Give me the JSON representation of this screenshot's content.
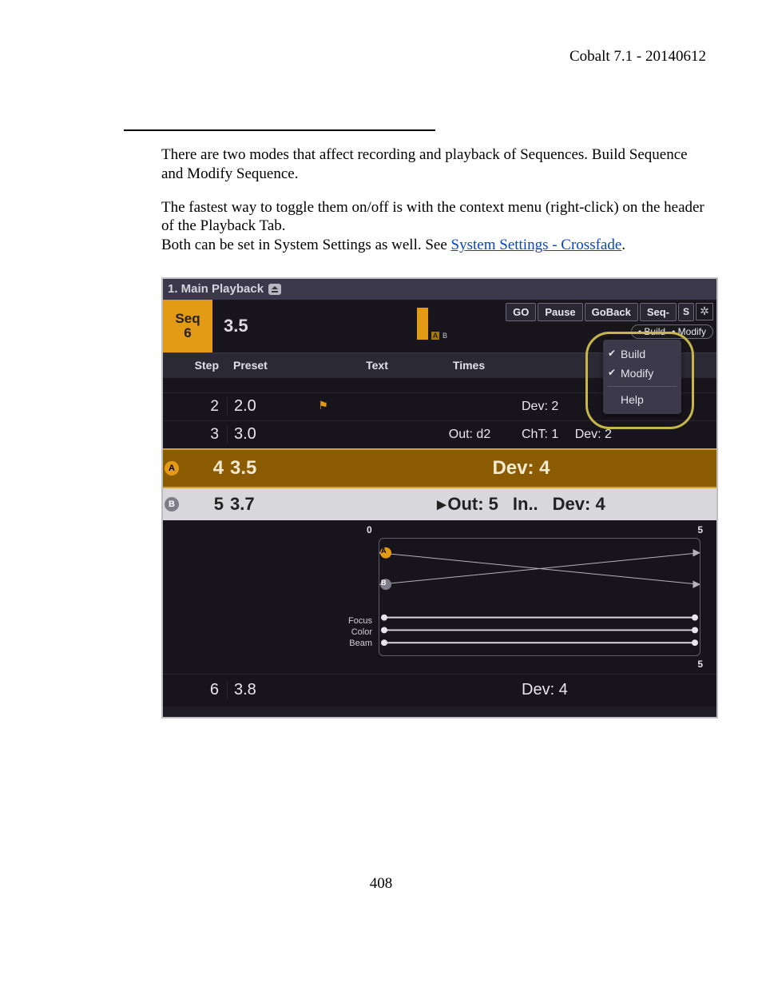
{
  "header": {
    "title": "Cobalt 7.1 - 20140612"
  },
  "para1": "There are two modes that affect recording and playback of Sequences. Build Sequence and Modify Sequence.",
  "para2a": "The fastest way to toggle them on/off is with the context menu (right-click) on the header of the Playback Tab.",
  "para2b": "Both can be set in System Settings as well. See ",
  "link": "System Settings - Crossfade",
  "para2c": ".",
  "page_number": "408",
  "tab": {
    "title": "1. Main Playback"
  },
  "seq": {
    "label1": "Seq",
    "label2": "6",
    "value": "3.5",
    "mini_a": "A",
    "mini_b": "B"
  },
  "transport": {
    "go": "GO",
    "pause": "Pause",
    "goback": "GoBack",
    "seqminus": "Seq-",
    "s": "S",
    "build": "Build",
    "modify": "Modify"
  },
  "ctx": {
    "build": "Build",
    "modify": "Modify",
    "help": "Help"
  },
  "cols": {
    "step": "Step",
    "preset": "Preset",
    "text": "Text",
    "times": "Times"
  },
  "rows": {
    "r2": {
      "step": "2",
      "preset": "2.0",
      "dev": "Dev: 2"
    },
    "r3": {
      "step": "3",
      "preset": "3.0",
      "times": "Out: d2",
      "cht": "ChT: 1",
      "dev": "Dev: 2"
    },
    "rA": {
      "step": "4",
      "preset": "3.5",
      "dev": "Dev: 4"
    },
    "rB": {
      "step": "5",
      "preset": "3.7",
      "out": "Out: 5",
      "in": "In..",
      "dev": "Dev: 4"
    },
    "r6": {
      "step": "6",
      "preset": "3.8",
      "dev": "Dev: 4"
    }
  },
  "xf": {
    "scale_start": "0",
    "scale_end_top": "5",
    "scale_end_bottom": "5",
    "a": "A",
    "b": "B",
    "focus": "Focus",
    "color": "Color",
    "beam": "Beam"
  }
}
